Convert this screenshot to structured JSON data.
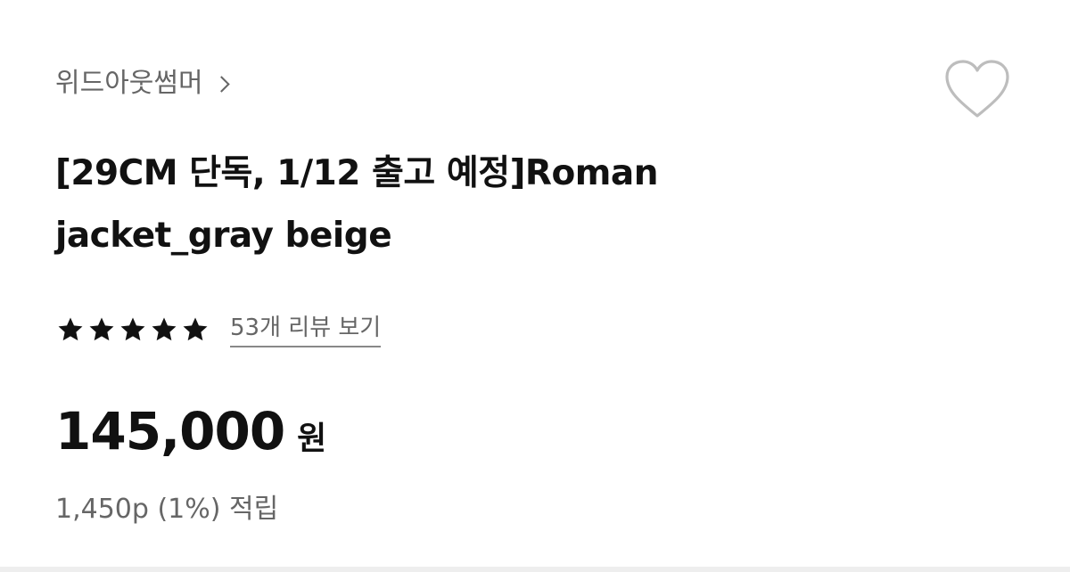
{
  "brand": {
    "name": "위드아웃썸머",
    "chevron_icon": "chevron-right-icon"
  },
  "wishlist": {
    "icon": "heart-outline-icon",
    "color": "#bdbdbd"
  },
  "product": {
    "title_line1": "[29CM 단독, 1/12 출고 예정]Roman",
    "title_line2": "jacket_gray beige"
  },
  "rating": {
    "stars_filled": 5,
    "stars_total": 5,
    "star_color": "#111111",
    "review_link": "53개 리뷰 보기"
  },
  "price": {
    "amount": "145,000",
    "unit": "원"
  },
  "points": {
    "text": "1,450p (1%) 적립"
  }
}
